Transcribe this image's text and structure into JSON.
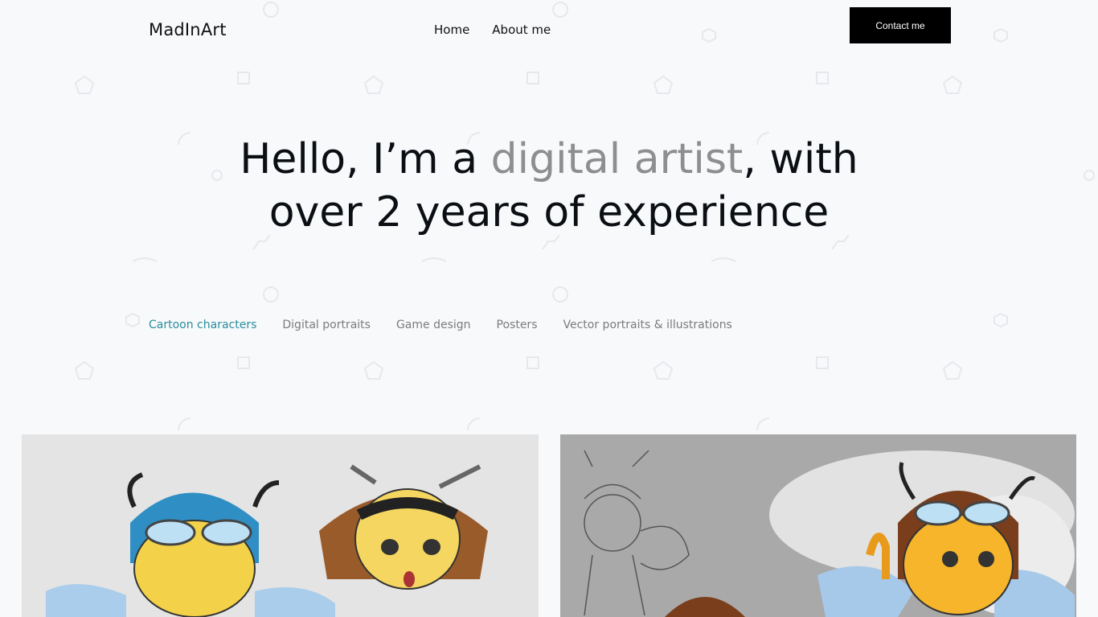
{
  "header": {
    "logo": "MadInArt",
    "nav": [
      {
        "label": "Home"
      },
      {
        "label": "About me"
      }
    ],
    "contact_label": "Contact me"
  },
  "hero": {
    "part1": "Hello, I’m a ",
    "highlight": "digital artist",
    "part2": ", with",
    "line2": "over 2 years of experience"
  },
  "filters": {
    "active_color": "#2a8c9c",
    "items": [
      {
        "label": "Cartoon characters",
        "active": true
      },
      {
        "label": "Digital portraits"
      },
      {
        "label": "Game design"
      },
      {
        "label": "Posters"
      },
      {
        "label": "Vector portraits & illustrations"
      }
    ]
  },
  "gallery": [
    {
      "subject": "cartoon-bee-characters-color"
    },
    {
      "subject": "cartoon-bee-character-sketch-and-color"
    }
  ]
}
